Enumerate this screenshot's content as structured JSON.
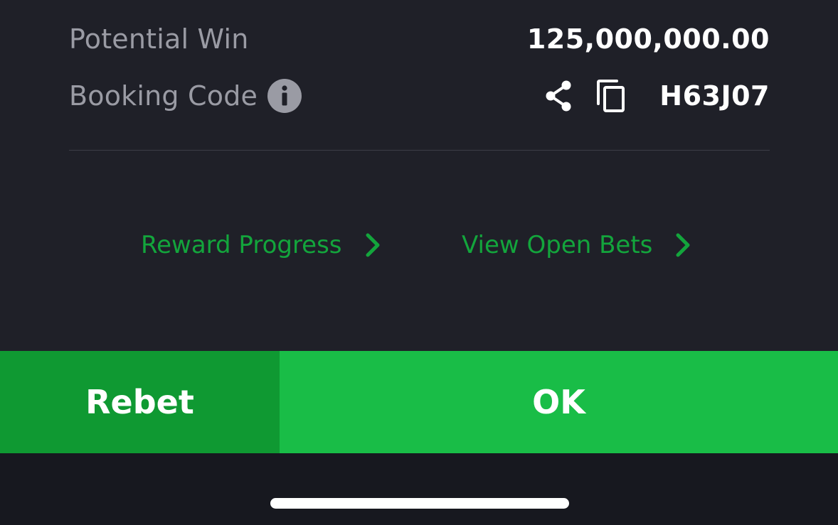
{
  "summary": {
    "potential_win_label": "Potential Win",
    "potential_win_value": "125,000,000.00",
    "booking_code_label": "Booking Code",
    "booking_code_value": "H63J07"
  },
  "links": {
    "reward_progress": "Reward Progress",
    "view_open_bets": "View Open Bets"
  },
  "actions": {
    "rebet_label": "Rebet",
    "ok_label": "OK"
  },
  "icons": {
    "info": "info-icon",
    "share": "share-icon",
    "copy": "copy-icon",
    "chevron": "chevron-right-icon"
  },
  "colors": {
    "background": "#1f2028",
    "accent_green": "#19bd47",
    "rebet_green": "#0f9932",
    "link_green": "#13a53c",
    "muted_text": "#9a9ba4"
  }
}
